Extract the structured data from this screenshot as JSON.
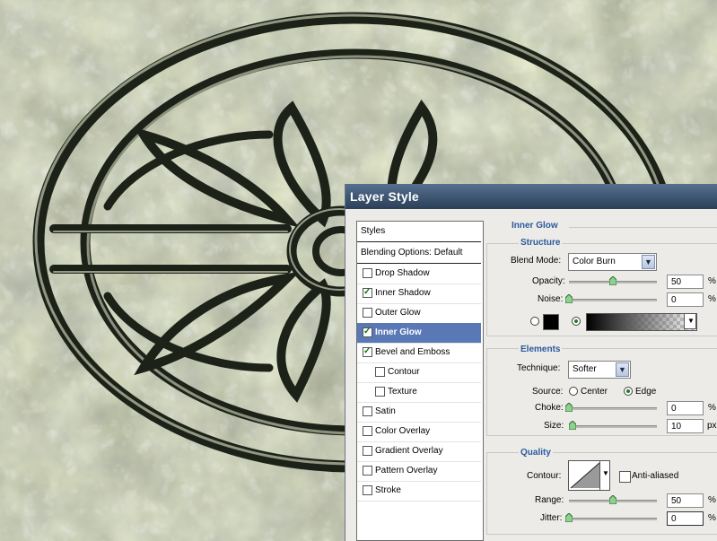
{
  "dialog": {
    "title": "Layer Style",
    "styles_list": [
      {
        "label": "Styles",
        "checked": null,
        "selected": false,
        "header": true
      },
      {
        "label": "Blending Options: Default",
        "checked": null,
        "selected": false,
        "header": true
      },
      {
        "label": "Drop Shadow",
        "checked": false,
        "selected": false
      },
      {
        "label": "Inner Shadow",
        "checked": true,
        "selected": false
      },
      {
        "label": "Outer Glow",
        "checked": false,
        "selected": false
      },
      {
        "label": "Inner Glow",
        "checked": true,
        "selected": true
      },
      {
        "label": "Bevel and Emboss",
        "checked": true,
        "selected": false
      },
      {
        "label": "Contour",
        "checked": false,
        "selected": false,
        "indent": true
      },
      {
        "label": "Texture",
        "checked": false,
        "selected": false,
        "indent": true
      },
      {
        "label": "Satin",
        "checked": false,
        "selected": false
      },
      {
        "label": "Color Overlay",
        "checked": false,
        "selected": false
      },
      {
        "label": "Gradient Overlay",
        "checked": false,
        "selected": false
      },
      {
        "label": "Pattern Overlay",
        "checked": false,
        "selected": false
      },
      {
        "label": "Stroke",
        "checked": false,
        "selected": false
      }
    ],
    "inner_glow": {
      "title": "Inner Glow",
      "structure": {
        "title": "Structure",
        "blend_mode_label": "Blend Mode:",
        "blend_mode_value": "Color Burn",
        "opacity_label": "Opacity:",
        "opacity_value": "50",
        "opacity_unit": "%",
        "opacity_level": 0.5,
        "noise_label": "Noise:",
        "noise_value": "0",
        "noise_unit": "%",
        "noise_level": 0.0,
        "color_swatch": "#000000"
      },
      "elements": {
        "title": "Elements",
        "technique_label": "Technique:",
        "technique_value": "Softer",
        "source_label": "Source:",
        "source_center": "Center",
        "source_edge": "Edge",
        "choke_label": "Choke:",
        "choke_value": "0",
        "choke_unit": "%",
        "choke_level": 0.0,
        "size_label": "Size:",
        "size_value": "10",
        "size_unit": "px",
        "size_level": 0.04
      },
      "quality": {
        "title": "Quality",
        "contour_label": "Contour:",
        "anti_aliased_label": "Anti-aliased",
        "range_label": "Range:",
        "range_value": "50",
        "range_unit": "%",
        "range_level": 0.5,
        "jitter_label": "Jitter:",
        "jitter_value": "0",
        "jitter_unit": "%",
        "jitter_level": 0.0
      }
    }
  },
  "colors": {
    "accent": "#2c5a9b",
    "selected_row": "#5a78b6",
    "check_green": "#0a7a0a"
  }
}
